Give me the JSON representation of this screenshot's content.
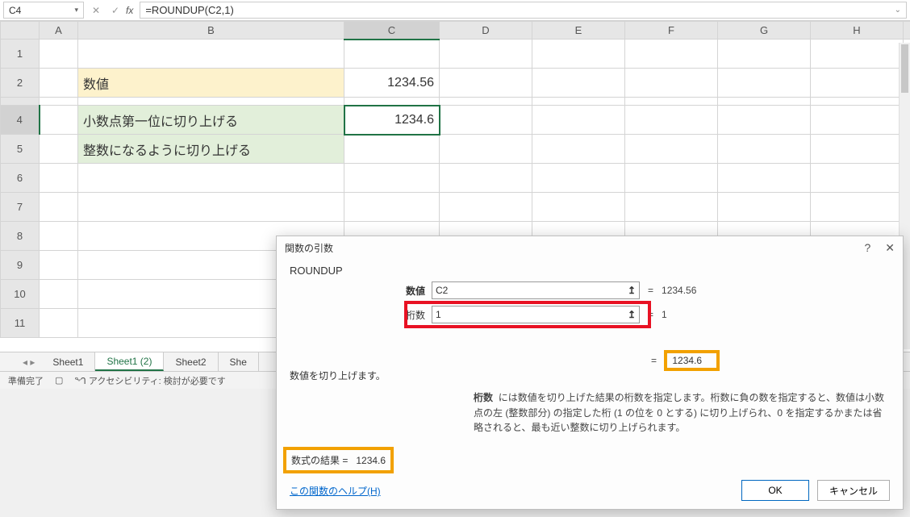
{
  "nameBox": "C4",
  "formula": "=ROUNDUP(C2,1)",
  "columns": [
    "A",
    "B",
    "C",
    "D",
    "E",
    "F",
    "G",
    "H"
  ],
  "rows": [
    "1",
    "2",
    "4",
    "5",
    "6",
    "7",
    "8",
    "9",
    "10",
    "11"
  ],
  "cells": {
    "B2": "数値",
    "C2": "1234.56",
    "B4": "小数点第一位に切り上げる",
    "C4": "1234.6",
    "B5": "整数になるように切り上げる"
  },
  "sheetTabs": [
    "Sheet1",
    "Sheet1 (2)",
    "Sheet2",
    "She"
  ],
  "activeTabIndex": 1,
  "status": {
    "ready": "準備完了",
    "accessibility": "アクセシビリティ: 検討が必要です"
  },
  "dialog": {
    "title": "関数の引数",
    "functionName": "ROUNDUP",
    "arg1": {
      "label": "数値",
      "value": "C2",
      "eval": "1234.56"
    },
    "arg2": {
      "label": "桁数",
      "value": "1",
      "eval": "1"
    },
    "resultPreview": "1234.6",
    "description": "数値を切り上げます。",
    "helpLabel": "桁数",
    "helpText": "には数値を切り上げた結果の桁数を指定します。桁数に負の数を指定すると、数値は小数点の左 (整数部分) の指定した桁 (1 の位を 0 とする) に切り上げられ、0 を指定するかまたは省略されると、最も近い整数に切り上げられます。",
    "formulaResultLabel": "数式の結果 =",
    "formulaResultValue": "1234.6",
    "helpLink": "この関数のヘルプ(H)",
    "ok": "OK",
    "cancel": "キャンセル"
  }
}
